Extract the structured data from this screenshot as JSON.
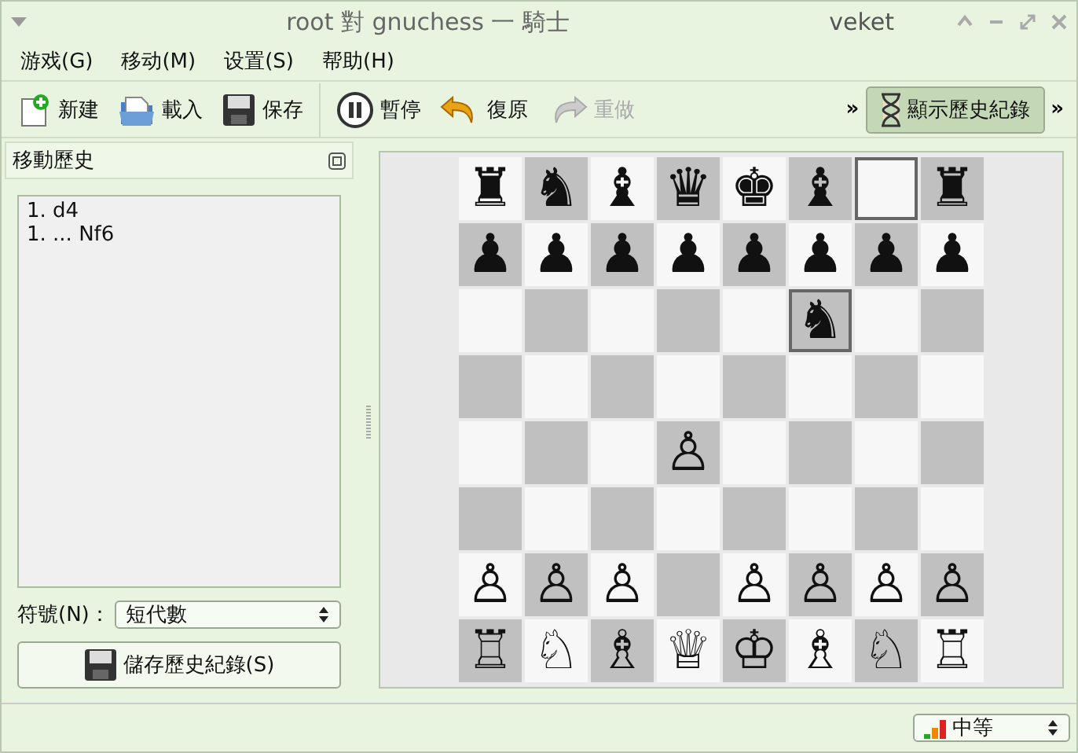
{
  "window": {
    "title": "root 對 gnuchess 一 騎士",
    "user": "veket"
  },
  "menu": [
    "游戏(G)",
    "移动(M)",
    "设置(S)",
    "帮助(H)"
  ],
  "toolbar": [
    {
      "kind": "new",
      "label": "新建",
      "disabled": false
    },
    {
      "kind": "open",
      "label": "載入",
      "disabled": false
    },
    {
      "kind": "save",
      "label": "保存",
      "disabled": false
    },
    {
      "kind": "pause",
      "label": "暫停",
      "disabled": false
    },
    {
      "kind": "undo",
      "label": "復原",
      "disabled": false
    },
    {
      "kind": "redo",
      "label": "重做",
      "disabled": true
    }
  ],
  "overflow": "»",
  "history_toggle": {
    "label": "顯示歷史紀錄",
    "selected": true
  },
  "overflow_end": "»",
  "history": {
    "title": "移動歷史",
    "moves": [
      "1. d4",
      "1. ... Nf6"
    ],
    "notation_label": "符號(N)：",
    "notation_value": "短代數",
    "save_button": "儲存歷史紀錄(S)"
  },
  "board": [
    [
      {
        "piece": "♜",
        "highlighted": false
      },
      {
        "piece": "♞",
        "highlighted": false
      },
      {
        "piece": "♝",
        "highlighted": false
      },
      {
        "piece": "♛",
        "highlighted": false
      },
      {
        "piece": "♚",
        "highlighted": false
      },
      {
        "piece": "♝",
        "highlighted": false
      },
      {
        "highlighted": true
      },
      {
        "piece": "♜",
        "highlighted": false
      }
    ],
    [
      {
        "piece": "♟",
        "highlighted": false
      },
      {
        "piece": "♟",
        "highlighted": false
      },
      {
        "piece": "♟",
        "highlighted": false
      },
      {
        "piece": "♟",
        "highlighted": false
      },
      {
        "piece": "♟",
        "highlighted": false
      },
      {
        "piece": "♟",
        "highlighted": false
      },
      {
        "piece": "♟",
        "highlighted": false
      },
      {
        "piece": "♟",
        "highlighted": false
      }
    ],
    [
      {
        "highlighted": false
      },
      {
        "highlighted": false
      },
      {
        "highlighted": false
      },
      {
        "highlighted": false
      },
      {
        "highlighted": false
      },
      {
        "piece": "♞",
        "highlighted": true
      },
      {
        "highlighted": false
      },
      {
        "highlighted": false
      }
    ],
    [
      {
        "highlighted": false
      },
      {
        "highlighted": false
      },
      {
        "highlighted": false
      },
      {
        "highlighted": false
      },
      {
        "highlighted": false
      },
      {
        "highlighted": false
      },
      {
        "highlighted": false
      },
      {
        "highlighted": false
      }
    ],
    [
      {
        "highlighted": false
      },
      {
        "highlighted": false
      },
      {
        "highlighted": false
      },
      {
        "piece": "♙",
        "highlighted": false
      },
      {
        "highlighted": false
      },
      {
        "highlighted": false
      },
      {
        "highlighted": false
      },
      {
        "highlighted": false
      }
    ],
    [
      {
        "highlighted": false
      },
      {
        "highlighted": false
      },
      {
        "highlighted": false
      },
      {
        "highlighted": false
      },
      {
        "highlighted": false
      },
      {
        "highlighted": false
      },
      {
        "highlighted": false
      },
      {
        "highlighted": false
      }
    ],
    [
      {
        "piece": "♙",
        "highlighted": false
      },
      {
        "piece": "♙",
        "highlighted": false
      },
      {
        "piece": "♙",
        "highlighted": false
      },
      {
        "highlighted": false
      },
      {
        "piece": "♙",
        "highlighted": false
      },
      {
        "piece": "♙",
        "highlighted": false
      },
      {
        "piece": "♙",
        "highlighted": false
      },
      {
        "piece": "♙",
        "highlighted": false
      }
    ],
    [
      {
        "piece": "♖",
        "highlighted": false
      },
      {
        "piece": "♘",
        "highlighted": false
      },
      {
        "piece": "♗",
        "highlighted": false
      },
      {
        "piece": "♕",
        "highlighted": false
      },
      {
        "piece": "♔",
        "highlighted": false
      },
      {
        "piece": "♗",
        "highlighted": false
      },
      {
        "piece": "♘",
        "highlighted": false
      },
      {
        "piece": "♖",
        "highlighted": false
      }
    ]
  ],
  "difficulty": {
    "label": "中等"
  }
}
